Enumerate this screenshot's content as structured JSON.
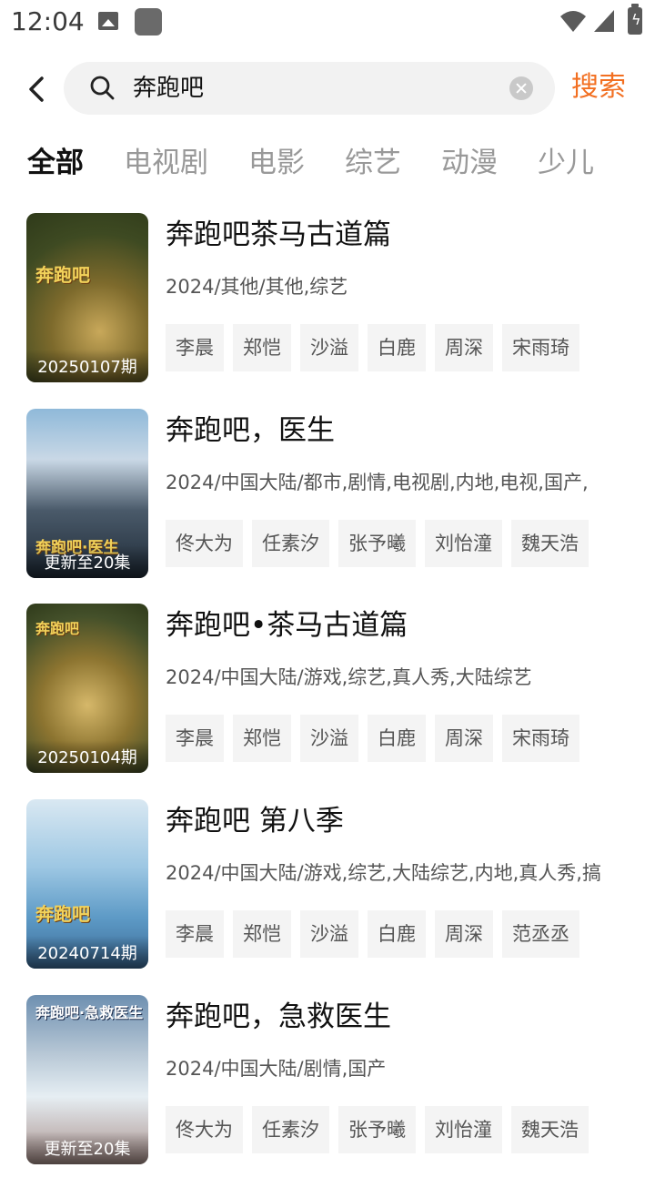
{
  "status_bar": {
    "time": "12:04"
  },
  "search": {
    "query": "奔跑吧",
    "search_label": "搜索"
  },
  "tabs": [
    {
      "label": "全部",
      "active": true
    },
    {
      "label": "电视剧"
    },
    {
      "label": "电影"
    },
    {
      "label": "综艺"
    },
    {
      "label": "动漫"
    },
    {
      "label": "少儿"
    }
  ],
  "results": [
    {
      "title": "奔跑吧茶马古道篇",
      "meta": "2024/其他/其他,综艺",
      "badge": "20250107期",
      "tags": [
        "李晨",
        "郑恺",
        "沙溢",
        "白鹿",
        "周深",
        "宋雨琦"
      ]
    },
    {
      "title": "奔跑吧，医生",
      "meta": "2024/中国大陆/都市,剧情,电视剧,内地,电视,国产,",
      "badge": "更新至20集",
      "tags": [
        "佟大为",
        "任素汐",
        "张予曦",
        "刘怡潼",
        "魏天浩"
      ]
    },
    {
      "title": "奔跑吧•茶马古道篇",
      "meta": "2024/中国大陆/游戏,综艺,真人秀,大陆综艺",
      "badge": "20250104期",
      "tags": [
        "李晨",
        "郑恺",
        "沙溢",
        "白鹿",
        "周深",
        "宋雨琦"
      ]
    },
    {
      "title": "奔跑吧 第八季",
      "meta": "2024/中国大陆/游戏,综艺,大陆综艺,内地,真人秀,搞",
      "badge": "20240714期",
      "tags": [
        "李晨",
        "郑恺",
        "沙溢",
        "白鹿",
        "周深",
        "范丞丞"
      ]
    },
    {
      "title": "奔跑吧，急救医生",
      "meta": "2024/中国大陆/剧情,国产",
      "badge": "更新至20集",
      "tags": [
        "佟大为",
        "任素汐",
        "张予曦",
        "刘怡潼",
        "魏天浩"
      ]
    }
  ]
}
